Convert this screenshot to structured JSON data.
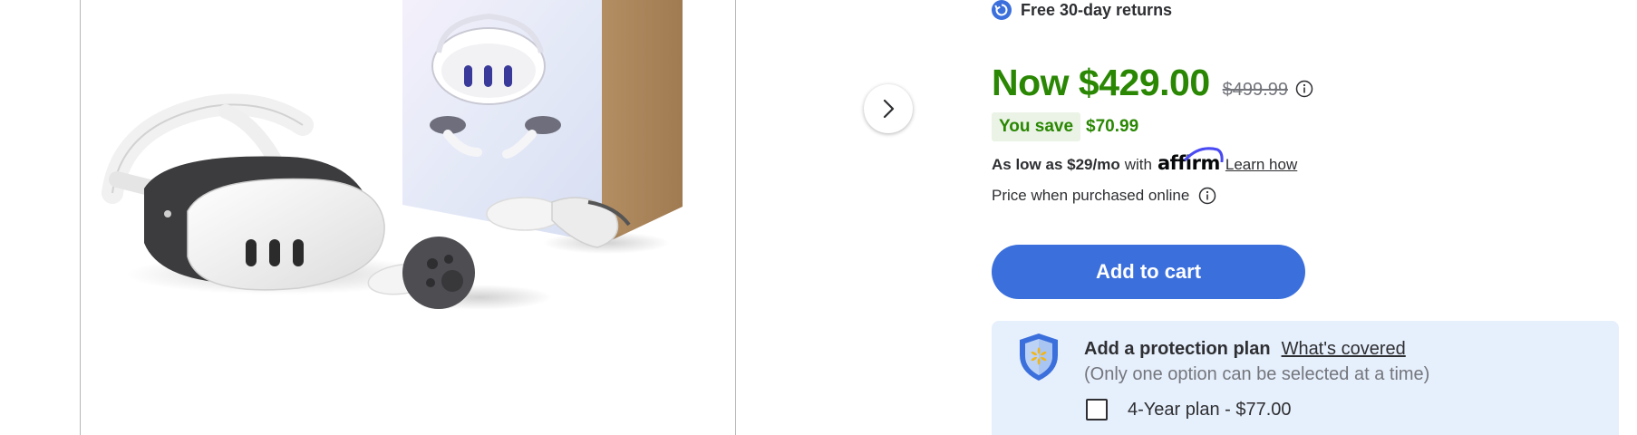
{
  "returns": {
    "icon": "returns-icon",
    "text": "Free 30-day returns"
  },
  "pricing": {
    "now_price": "Now $429.00",
    "was_price": "$499.99",
    "you_save_label": "You save",
    "save_amount": "$70.99",
    "price_color": "#2a8703"
  },
  "affirm": {
    "prefix": "As low as $29/mo",
    "with": "with",
    "logo_text": "affirm",
    "learn_how": "Learn how"
  },
  "price_note": "Price when purchased online",
  "cart": {
    "add_to_cart_label": "Add to cart",
    "button_color": "#3b6fdc"
  },
  "protection": {
    "title": "Add a protection plan",
    "whats_covered": "What's covered",
    "subtitle": "(Only one option can be selected at a time)",
    "options": [
      {
        "label": "4-Year plan - $77.00",
        "checked": false
      }
    ],
    "panel_color": "#e6effc"
  },
  "carousel": {
    "next_icon": "chevron-right-icon"
  }
}
